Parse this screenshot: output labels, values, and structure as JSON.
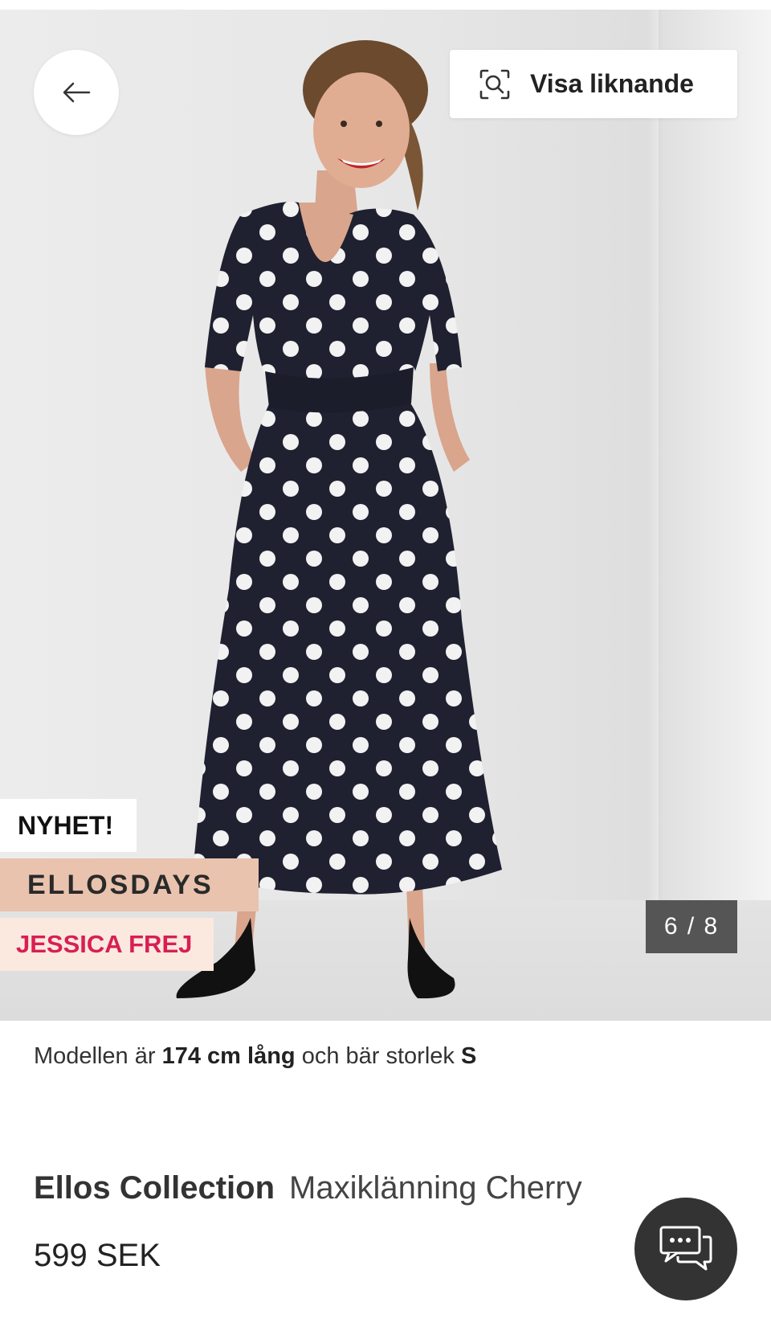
{
  "gallery": {
    "back_icon": "arrow-left-icon",
    "similar_button": {
      "icon": "visual-search-icon",
      "label": "Visa liknande"
    },
    "badges": {
      "new": "NYHET!",
      "campaign": "ELLOSDAYS",
      "collab": "JESSICA FREJ"
    },
    "counter": "6 / 8",
    "image_alt_colors": {
      "dress": "#1f2030",
      "dots": "#f2f2f2"
    }
  },
  "model_info": {
    "prefix": "Modellen är",
    "height": "174 cm lång",
    "middle": "och bär storlek",
    "size": "S"
  },
  "product": {
    "brand": "Ellos Collection",
    "name": "Maxiklänning Cherry",
    "price": "599 SEK"
  },
  "chat": {
    "icon": "chat-icon"
  },
  "colors": {
    "campaign_bg": "#e9c3ae",
    "collab_bg": "#fbe9df",
    "collab_text": "#d81f54",
    "counter_bg": "#555555"
  }
}
